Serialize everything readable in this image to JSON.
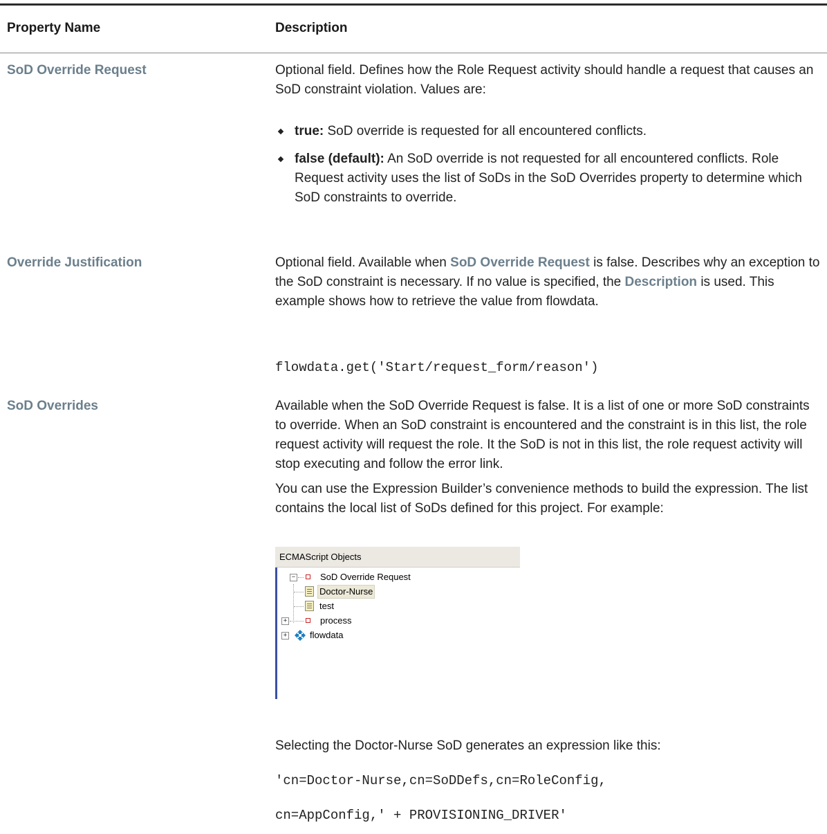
{
  "table": {
    "header": {
      "property_name": "Property Name",
      "description": "Description"
    }
  },
  "rows": {
    "sod_override_request": {
      "name": "SoD Override Request",
      "description": "Optional field. Defines how the Role Request activity should handle a request that causes an SoD constraint violation. Values are:",
      "options": [
        {
          "term": "true:",
          "text": " SoD override is requested for all encountered conflicts."
        },
        {
          "term": "false (default):",
          "text": " An SoD override is not requested for all encountered conflicts. Role Request activity uses the list of SoDs in the SoD Overrides property to determine which SoD constraints to override."
        }
      ]
    },
    "override_justification": {
      "name": "Override Justification",
      "desc_part1": "Optional field. Available when ",
      "desc_link1": "SoD Override Request",
      "desc_part2": " is false. Describes why an exception to the SoD constraint is necessary. If no value is specified, the ",
      "desc_link2": "Description",
      "desc_part3": " is used. This example shows how to retrieve the value from flowdata.",
      "code": "flowdata.get('Start/request_form/reason')"
    },
    "sod_overrides": {
      "name": "SoD Overrides",
      "description": "Available when the SoD Override Request is false. It is a list of one or more SoD constraints to override. When an SoD constraint is encountered and the constraint is in this list, the role request activity will request the role. It the SoD is not in this list, the role request activity will stop executing and follow the error link.",
      "description2": "You can use the Expression Builder’s convenience methods to build the expression. The list contains the local list of SoDs defined for this project. For example:",
      "selecting_text": "Selecting the Doctor-Nurse SoD generates an expression like this:",
      "code_line1": "'cn=Doctor-Nurse,cn=SoDDefs,cn=RoleConfig,",
      "code_line2": "cn=AppConfig,' + PROVISIONING_DRIVER'"
    }
  },
  "tree_screenshot": {
    "title": "ECMAScript Objects",
    "nodes": {
      "sod_override_request": "SoD Override Request",
      "doctor_nurse": "Doctor-Nurse",
      "test": "test",
      "process": "process",
      "flowdata": "flowdata"
    },
    "expander_collapsed": "+",
    "expander_expanded": "−",
    "colors": {
      "accent_border": "#3a4fa3",
      "node_square": "#cc2222",
      "flowdata_icon": "#1f7fbf"
    }
  },
  "colors": {
    "link_text": "#6b7f8c",
    "body_text": "#222222"
  }
}
